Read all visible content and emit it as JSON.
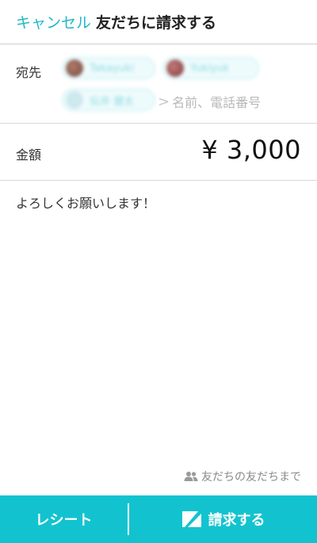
{
  "header": {
    "cancel_label": "キャンセル",
    "title": "友だちに請求する"
  },
  "recipients": {
    "label": "宛先",
    "chips": [
      {
        "name": "Takayuki"
      },
      {
        "name": "Yukiyuk"
      },
      {
        "name": "伝井 健太"
      }
    ],
    "input_placeholder": "名前、電話番号",
    "input_chevron": ">"
  },
  "amount": {
    "label": "金額",
    "value": "¥ 3,000"
  },
  "message": "よろしくお願いします！",
  "scope": {
    "label": "友だちの友だちまで",
    "icon": "people-icon"
  },
  "bottom": {
    "receipt_label": "レシート",
    "request_label": "請求する",
    "request_icon": "request-card-icon"
  },
  "colors": {
    "accent": "#1fb8c6",
    "bottom_bar": "#12c3cf"
  }
}
